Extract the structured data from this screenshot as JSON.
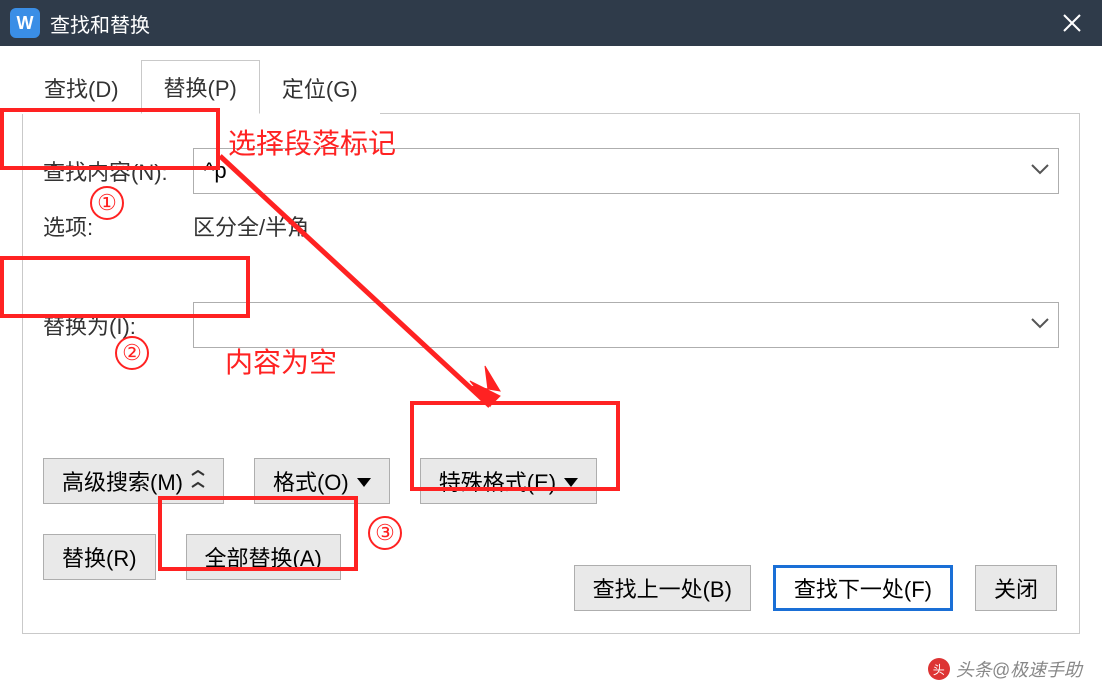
{
  "window": {
    "title": "查找和替换"
  },
  "tabs": {
    "find": {
      "label": "查找(D)"
    },
    "replace": {
      "label": "替换(P)"
    },
    "goto": {
      "label": "定位(G)"
    }
  },
  "find": {
    "label": "查找内容(N):",
    "value": "^p",
    "options_label": "选项:",
    "options_value": "区分全/半角"
  },
  "replace": {
    "label": "替换为(I):",
    "value": ""
  },
  "buttons": {
    "advanced": "高级搜索(M)",
    "format": "格式(O)",
    "special": "特殊格式(E)",
    "replace_one": "替换(R)",
    "replace_all": "全部替换(A)",
    "find_prev": "查找上一处(B)",
    "find_next": "查找下一处(F)",
    "close": "关闭"
  },
  "annotations": {
    "a1_text": "选择段落标记",
    "a2_text": "内容为空",
    "n1": "①",
    "n2": "②",
    "n3": "③"
  },
  "watermark": "头条@极速手助"
}
